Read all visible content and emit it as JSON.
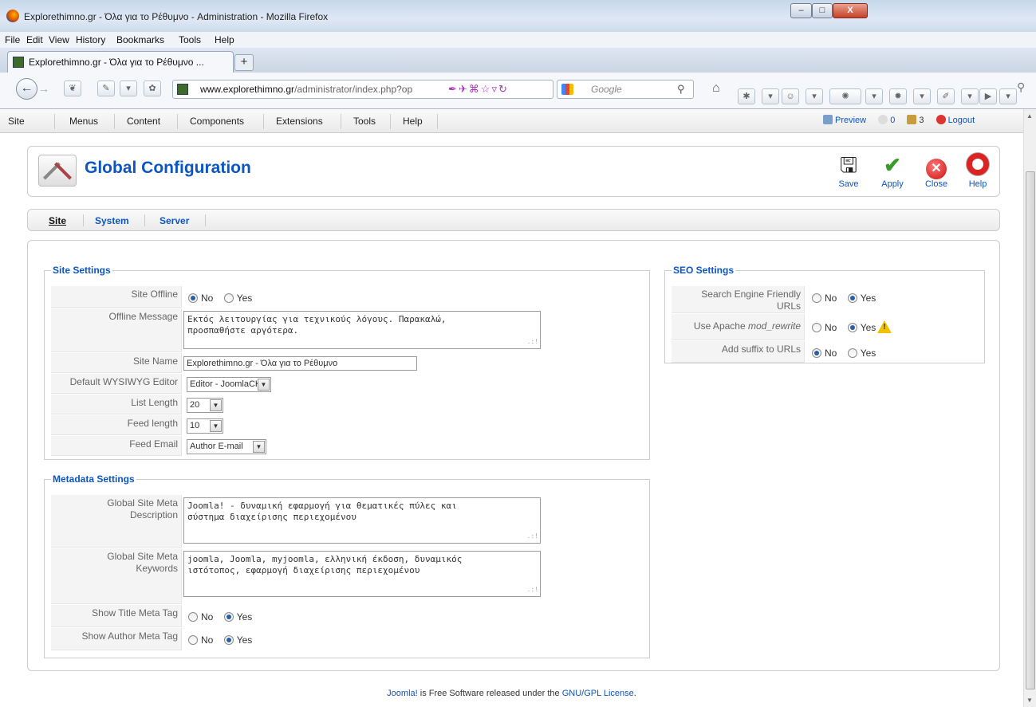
{
  "window": {
    "title": "Explorethimno.gr - Όλα για το Ρέθυμνο - Administration - Mozilla Firefox",
    "min": "‒",
    "max": "□",
    "close": "X"
  },
  "menubar": [
    "File",
    "Edit",
    "View",
    "History",
    "Bookmarks",
    "Tools",
    "Help"
  ],
  "tab": {
    "title": "Explorethimno.gr - Όλα για το Ρέθυμνο ...",
    "new_tab": "+"
  },
  "nav": {
    "url_domain": "www.explorethimno.gr",
    "url_path": "/administrator/index.php?op",
    "search_placeholder": "Google"
  },
  "admin_menu": {
    "items": [
      "Site",
      "Menus",
      "Content",
      "Components",
      "Extensions",
      "Tools",
      "Help"
    ],
    "preview": "Preview",
    "messages": "0",
    "users": "3",
    "logout": "Logout"
  },
  "toolbar": {
    "title": "Global Configuration",
    "save": "Save",
    "apply": "Apply",
    "close": "Close",
    "help": "Help"
  },
  "subnav": [
    "Site",
    "System",
    "Server"
  ],
  "site_settings": {
    "legend": "Site Settings",
    "site_offline_label": "Site Offline",
    "no": "No",
    "yes": "Yes",
    "offline_message_label": "Offline Message",
    "offline_message": "Εκτός λειτουργίας για τεχνικούς λόγους. Παρακαλώ,\nπροσπαθήστε αργότερα.",
    "site_name_label": "Site Name",
    "site_name": "Explorethimno.gr - Όλα για το Ρέθυμνο",
    "editor_label": "Default WYSIWYG Editor",
    "editor": "Editor - JoomlaCK",
    "list_length_label": "List Length",
    "list_length": "20",
    "feed_length_label": "Feed length",
    "feed_length": "10",
    "feed_email_label": "Feed Email",
    "feed_email": "Author E-mail"
  },
  "metadata_settings": {
    "legend": "Metadata Settings",
    "desc_label_1": "Global Site Meta",
    "desc_label_2": "Description",
    "description": "Joomla! - δυναμική εφαρμογή για θεματικές πύλες και\nσύστημα διαχείρισης περιεχομένου",
    "kw_label_1": "Global Site Meta",
    "kw_label_2": "Keywords",
    "keywords": "joomla, Joomla, myjoomla, ελληνική έκδοση, δυναμικός\nιστότοπος, εφαρμογή διαχείρισης περιεχομένου",
    "show_title_label": "Show Title Meta Tag",
    "show_author_label": "Show Author Meta Tag"
  },
  "seo_settings": {
    "legend": "SEO Settings",
    "sef_label_1": "Search Engine Friendly",
    "sef_label_2": "URLs",
    "rewrite_label_pre": "Use Apache ",
    "rewrite_label_em": "mod_rewrite",
    "suffix_label": "Add suffix to URLs"
  },
  "footer": {
    "joomla": "Joomla!",
    "text": " is Free Software released under the ",
    "license": "GNU/GPL License",
    "end": "."
  },
  "colors": {
    "link": "#0b55c4",
    "label_bg": "#f4f4f4"
  }
}
